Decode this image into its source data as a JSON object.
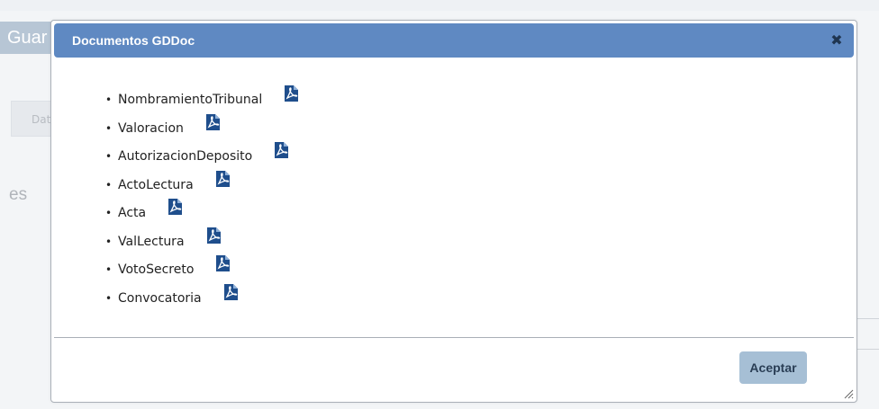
{
  "background": {
    "guardar_label": "Guar",
    "tab_label": "Dat",
    "heading_fragment": "es"
  },
  "dialog": {
    "title": "Documentos GDDoc",
    "close_symbol": "✖",
    "documents": [
      {
        "label": "NombramientoTribunal",
        "icon": "pdf-icon"
      },
      {
        "label": "Valoracion",
        "icon": "pdf-icon"
      },
      {
        "label": "AutorizacionDeposito",
        "icon": "pdf-icon"
      },
      {
        "label": "ActoLectura",
        "icon": "pdf-icon"
      },
      {
        "label": "Acta",
        "icon": "pdf-icon"
      },
      {
        "label": "ValLectura",
        "icon": "pdf-icon"
      },
      {
        "label": "VotoSecreto",
        "icon": "pdf-icon"
      },
      {
        "label": "Convocatoria",
        "icon": "pdf-icon"
      }
    ],
    "accept_label": "Aceptar"
  },
  "colors": {
    "titlebar": "#5f89c2",
    "accept_button": "#a6bfd5",
    "pdf_icon": "#1f4e8c"
  }
}
